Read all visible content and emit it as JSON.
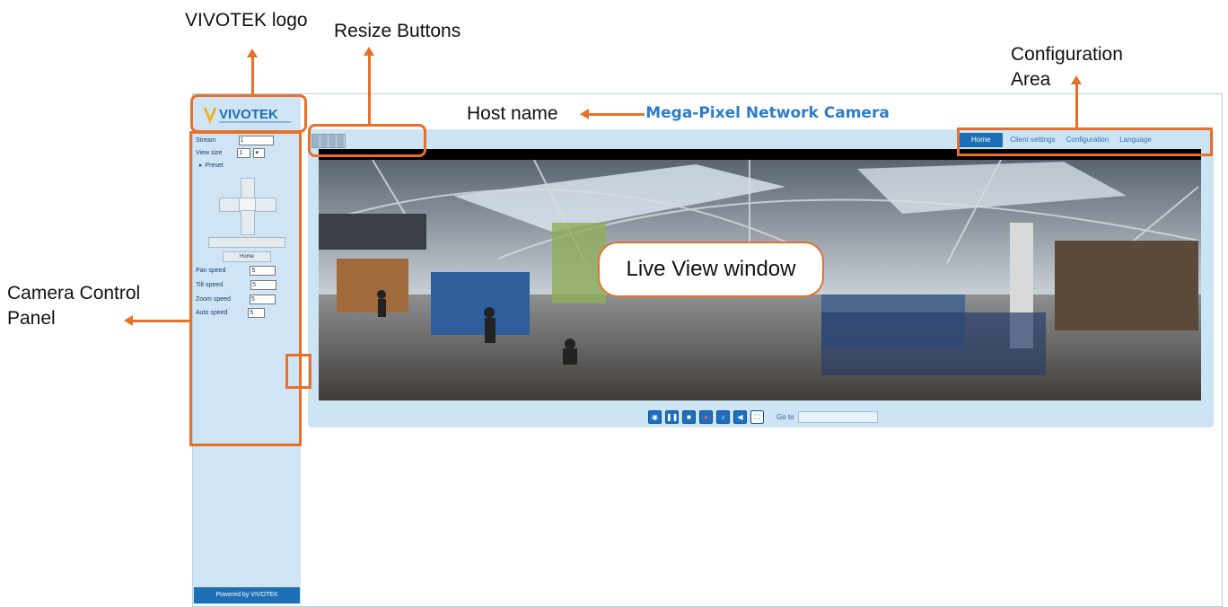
{
  "annotations": {
    "vivotek_logo": "VIVOTEK logo",
    "resize_buttons": "Resize Buttons",
    "configuration_area_line1": "Configuration",
    "configuration_area_line2": "Area",
    "host_name": "Host name",
    "camera_control_line1": "Camera Control",
    "camera_control_line2": "Panel",
    "live_view_window": "Live View window"
  },
  "header": {
    "logo_text": "VIVOTEK",
    "host_name": "Mega-Pixel Network Camera"
  },
  "resize_buttons": [
    "",
    "",
    "",
    ""
  ],
  "config_nav": {
    "items": [
      "Home",
      "Client settings",
      "Configuration",
      "Language"
    ],
    "active": "Home"
  },
  "sidebar": {
    "stream_label": "Stream",
    "stream_value": "1",
    "view_size_label": "View size",
    "view_size_value": "1",
    "preset_label": "Preset",
    "pan_label": "Pan speed",
    "tilt_label": "Tilt speed",
    "zoom_label": "Zoom speed",
    "auto_label": "Auto speed",
    "speed_value": "5",
    "home_button": "Home",
    "powered_by": "Powered by VIVOTEK"
  },
  "video": {
    "timestamp": ""
  },
  "controls": {
    "goto_label": "Go to",
    "goto_value": ""
  },
  "colors": {
    "accent": "#e8702a",
    "brand_blue": "#1d6fb6",
    "panel": "#cde4f5"
  }
}
